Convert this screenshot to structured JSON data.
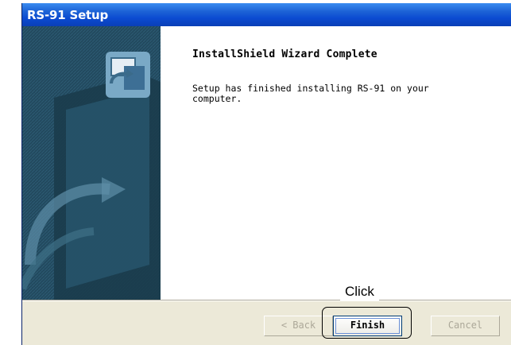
{
  "window": {
    "title": "RS-91 Setup"
  },
  "wizard": {
    "heading": "InstallShield Wizard Complete",
    "message": "Setup has finished installing RS-91 on your computer."
  },
  "buttons": {
    "back": "< Back",
    "finish": "Finish",
    "cancel": "Cancel"
  },
  "annotation": {
    "label": "Click"
  },
  "colors": {
    "titlebar": "#0b4bd1",
    "dialog_bg": "#ece9d8",
    "panel_bg": "#21485c",
    "disabled_text": "#aca899"
  },
  "icons": [
    "setup-computer-icon"
  ]
}
